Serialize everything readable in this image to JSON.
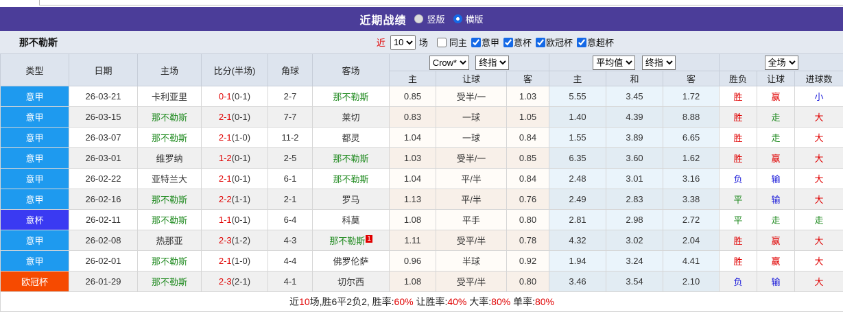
{
  "top": {
    "title": "近期战绩",
    "radios": [
      {
        "label": "竖版",
        "selected": false
      },
      {
        "label": "横版",
        "selected": true
      }
    ]
  },
  "toolbar": {
    "team": "那不勒斯",
    "near_label": "近",
    "matches_value": "10",
    "matches_suffix": "场",
    "checkboxes": [
      {
        "label": "同主",
        "checked": false
      },
      {
        "label": "意甲",
        "checked": true
      },
      {
        "label": "意杯",
        "checked": true
      },
      {
        "label": "欧冠杯",
        "checked": true
      },
      {
        "label": "意超杯",
        "checked": true
      }
    ]
  },
  "colors": {
    "red": "#e00000",
    "blue": "#1b1bd9",
    "green": "#1f8a1f"
  },
  "table": {
    "base_headers": [
      "类型",
      "日期",
      "主场",
      "比分(半场)",
      "角球",
      "客场"
    ],
    "league_colors": {
      "意甲": "#1e9aef",
      "意杯": "#3a3af2",
      "欧冠杯": "#f64a00"
    },
    "odds1": {
      "select1": "Crow*",
      "select2": "终指",
      "cols": [
        "主",
        "让球",
        "客"
      ]
    },
    "odds2": {
      "select1": "平均值",
      "select2": "终指",
      "cols": [
        "主",
        "和",
        "客"
      ]
    },
    "result": {
      "select": "全场",
      "cols": [
        "胜负",
        "让球",
        "进球数"
      ]
    },
    "rows": [
      {
        "league": "意甲",
        "date": "26-03-21",
        "home": "卡利亚里",
        "home_green": false,
        "score": "0-1",
        "half": "(0-1)",
        "corner": "2-7",
        "away": "那不勒斯",
        "away_green": true,
        "away_sup": "",
        "o1": [
          "0.85",
          "受半/一",
          "1.03"
        ],
        "o2": [
          "5.55",
          "3.45",
          "1.72"
        ],
        "res": [
          {
            "t": "胜",
            "c": "red"
          },
          {
            "t": "赢",
            "c": "red"
          },
          {
            "t": "小",
            "c": "blue"
          }
        ]
      },
      {
        "league": "意甲",
        "date": "26-03-15",
        "home": "那不勒斯",
        "home_green": true,
        "score": "2-1",
        "half": "(0-1)",
        "corner": "7-7",
        "away": "莱切",
        "away_green": false,
        "away_sup": "",
        "o1": [
          "0.83",
          "一球",
          "1.05"
        ],
        "o2": [
          "1.40",
          "4.39",
          "8.88"
        ],
        "res": [
          {
            "t": "胜",
            "c": "red"
          },
          {
            "t": "走",
            "c": "green"
          },
          {
            "t": "大",
            "c": "red"
          }
        ]
      },
      {
        "league": "意甲",
        "date": "26-03-07",
        "home": "那不勒斯",
        "home_green": true,
        "score": "2-1",
        "half": "(1-0)",
        "corner": "11-2",
        "away": "都灵",
        "away_green": false,
        "away_sup": "",
        "o1": [
          "1.04",
          "一球",
          "0.84"
        ],
        "o2": [
          "1.55",
          "3.89",
          "6.65"
        ],
        "res": [
          {
            "t": "胜",
            "c": "red"
          },
          {
            "t": "走",
            "c": "green"
          },
          {
            "t": "大",
            "c": "red"
          }
        ]
      },
      {
        "league": "意甲",
        "date": "26-03-01",
        "home": "维罗纳",
        "home_green": false,
        "score": "1-2",
        "half": "(0-1)",
        "corner": "2-5",
        "away": "那不勒斯",
        "away_green": true,
        "away_sup": "",
        "o1": [
          "1.03",
          "受半/一",
          "0.85"
        ],
        "o2": [
          "6.35",
          "3.60",
          "1.62"
        ],
        "res": [
          {
            "t": "胜",
            "c": "red"
          },
          {
            "t": "赢",
            "c": "red"
          },
          {
            "t": "大",
            "c": "red"
          }
        ]
      },
      {
        "league": "意甲",
        "date": "26-02-22",
        "home": "亚特兰大",
        "home_green": false,
        "score": "2-1",
        "half": "(0-1)",
        "corner": "6-1",
        "away": "那不勒斯",
        "away_green": true,
        "away_sup": "",
        "o1": [
          "1.04",
          "平/半",
          "0.84"
        ],
        "o2": [
          "2.48",
          "3.01",
          "3.16"
        ],
        "res": [
          {
            "t": "负",
            "c": "blue"
          },
          {
            "t": "输",
            "c": "blue"
          },
          {
            "t": "大",
            "c": "red"
          }
        ]
      },
      {
        "league": "意甲",
        "date": "26-02-16",
        "home": "那不勒斯",
        "home_green": true,
        "score": "2-2",
        "half": "(1-1)",
        "corner": "2-1",
        "away": "罗马",
        "away_green": false,
        "away_sup": "",
        "o1": [
          "1.13",
          "平/半",
          "0.76"
        ],
        "o2": [
          "2.49",
          "2.83",
          "3.38"
        ],
        "res": [
          {
            "t": "平",
            "c": "green"
          },
          {
            "t": "输",
            "c": "blue"
          },
          {
            "t": "大",
            "c": "red"
          }
        ]
      },
      {
        "league": "意杯",
        "date": "26-02-11",
        "home": "那不勒斯",
        "home_green": true,
        "score": "1-1",
        "half": "(0-1)",
        "corner": "6-4",
        "away": "科莫",
        "away_green": false,
        "away_sup": "",
        "o1": [
          "1.08",
          "平手",
          "0.80"
        ],
        "o2": [
          "2.81",
          "2.98",
          "2.72"
        ],
        "res": [
          {
            "t": "平",
            "c": "green"
          },
          {
            "t": "走",
            "c": "green"
          },
          {
            "t": "走",
            "c": "green"
          }
        ]
      },
      {
        "league": "意甲",
        "date": "26-02-08",
        "home": "热那亚",
        "home_green": false,
        "score": "2-3",
        "half": "(1-2)",
        "corner": "4-3",
        "away": "那不勒斯",
        "away_green": true,
        "away_sup": "1",
        "o1": [
          "1.11",
          "受平/半",
          "0.78"
        ],
        "o2": [
          "4.32",
          "3.02",
          "2.04"
        ],
        "res": [
          {
            "t": "胜",
            "c": "red"
          },
          {
            "t": "赢",
            "c": "red"
          },
          {
            "t": "大",
            "c": "red"
          }
        ]
      },
      {
        "league": "意甲",
        "date": "26-02-01",
        "home": "那不勒斯",
        "home_green": true,
        "score": "2-1",
        "half": "(1-0)",
        "corner": "4-4",
        "away": "佛罗伦萨",
        "away_green": false,
        "away_sup": "",
        "o1": [
          "0.96",
          "半球",
          "0.92"
        ],
        "o2": [
          "1.94",
          "3.24",
          "4.41"
        ],
        "res": [
          {
            "t": "胜",
            "c": "red"
          },
          {
            "t": "赢",
            "c": "red"
          },
          {
            "t": "大",
            "c": "red"
          }
        ]
      },
      {
        "league": "欧冠杯",
        "date": "26-01-29",
        "home": "那不勒斯",
        "home_green": true,
        "score": "2-3",
        "half": "(2-1)",
        "corner": "4-1",
        "away": "切尔西",
        "away_green": false,
        "away_sup": "",
        "o1": [
          "1.08",
          "受平/半",
          "0.80"
        ],
        "o2": [
          "3.46",
          "3.54",
          "2.10"
        ],
        "res": [
          {
            "t": "负",
            "c": "blue"
          },
          {
            "t": "输",
            "c": "blue"
          },
          {
            "t": "大",
            "c": "red"
          }
        ]
      }
    ]
  },
  "footer": {
    "parts": [
      {
        "text": "近",
        "red": false
      },
      {
        "text": "10",
        "red": true
      },
      {
        "text": "场,胜6平2负2, 胜率:",
        "red": false
      },
      {
        "text": "60%",
        "red": true
      },
      {
        "text": " 让胜率:",
        "red": false
      },
      {
        "text": "40%",
        "red": true
      },
      {
        "text": " 大率:",
        "red": false
      },
      {
        "text": "80%",
        "red": true
      },
      {
        "text": " 单率:",
        "red": false
      },
      {
        "text": "80%",
        "red": true
      }
    ]
  }
}
